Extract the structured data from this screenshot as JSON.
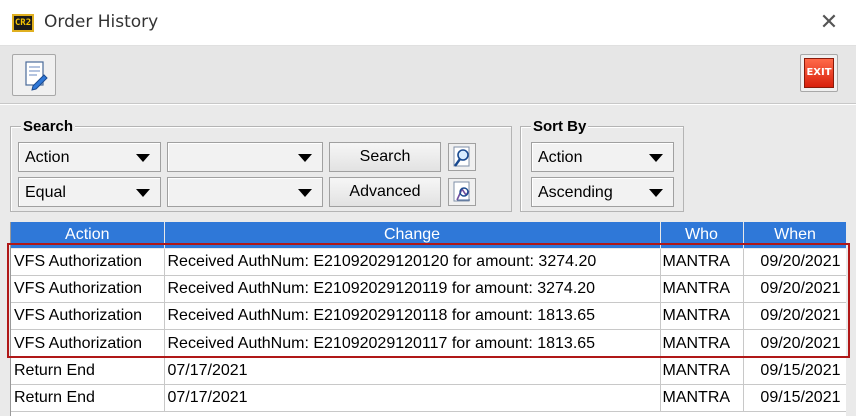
{
  "window": {
    "title": "Order History",
    "app_icon_text": "CR2",
    "close_glyph": "✕"
  },
  "toolbar": {
    "left_icon": "document-edit-icon",
    "exit_label": "EXIT"
  },
  "search": {
    "label": "Search",
    "row1": {
      "field": "Action",
      "value": "",
      "button": "Search"
    },
    "row2": {
      "operator": "Equal",
      "value": "",
      "button": "Advanced"
    }
  },
  "sort": {
    "label": "Sort By",
    "field": "Action",
    "order": "Ascending"
  },
  "table": {
    "columns": [
      "Action",
      "Change",
      "Who",
      "When"
    ],
    "rows": [
      {
        "action": "VFS Authorization",
        "change": "Received AuthNum: E21092029120120 for amount: 3274.20",
        "who": "MANTRA",
        "when": "09/20/2021"
      },
      {
        "action": "VFS Authorization",
        "change": "Received AuthNum: E21092029120119 for amount: 3274.20",
        "who": "MANTRA",
        "when": "09/20/2021"
      },
      {
        "action": "VFS Authorization",
        "change": "Received AuthNum: E21092029120118 for amount: 1813.65",
        "who": "MANTRA",
        "when": "09/20/2021"
      },
      {
        "action": "VFS Authorization",
        "change": "Received AuthNum: E21092029120117 for amount: 1813.65",
        "who": "MANTRA",
        "when": "09/20/2021"
      },
      {
        "action": "Return End",
        "change": "07/17/2021",
        "who": "MANTRA",
        "when": "09/15/2021"
      },
      {
        "action": "Return End",
        "change": "07/17/2021",
        "who": "MANTRA",
        "when": "09/15/2021"
      }
    ]
  },
  "colors": {
    "header_blue": "#2f78d8",
    "highlight_red": "#b01818",
    "exit_red": "#d8200c"
  }
}
